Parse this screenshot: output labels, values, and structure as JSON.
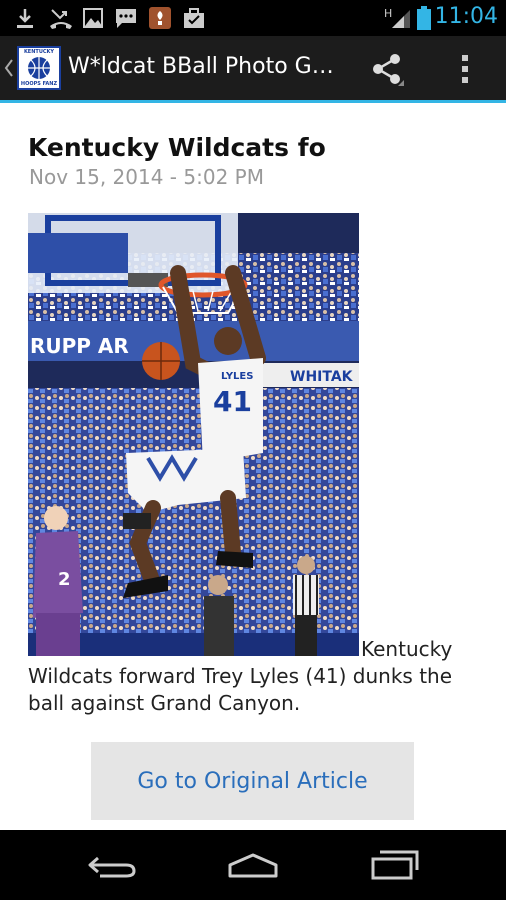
{
  "status_bar": {
    "time": "11:04",
    "icons": [
      "download-icon",
      "missed-call-icon",
      "gallery-icon",
      "chat-icon",
      "app-icon",
      "briefcase-icon",
      "signal-icon",
      "battery-icon"
    ]
  },
  "action_bar": {
    "logo_text_top": "KENTUCKY",
    "logo_text_bottom": "HOOPS FANZ",
    "title": "W*ldcat BBall Photo G…"
  },
  "article": {
    "headline": "Kentucky Wildcats fo",
    "date": "Nov 15, 2014 - 5:02 PM",
    "photo_jersey_name": "LYLES",
    "photo_jersey_number": "41",
    "photo_banner_left": "RUPP AR",
    "photo_banner_right": "WHITAK",
    "photo_opponent_number": "2",
    "caption": "Kentucky Wildcats forward Trey Lyles (41) dunks the ball against Grand Canyon.",
    "button_label": "Go to Original Article"
  },
  "colors": {
    "accent": "#33b5e5",
    "button_text": "#2a6ebb",
    "button_bg": "#e5e5e5"
  }
}
